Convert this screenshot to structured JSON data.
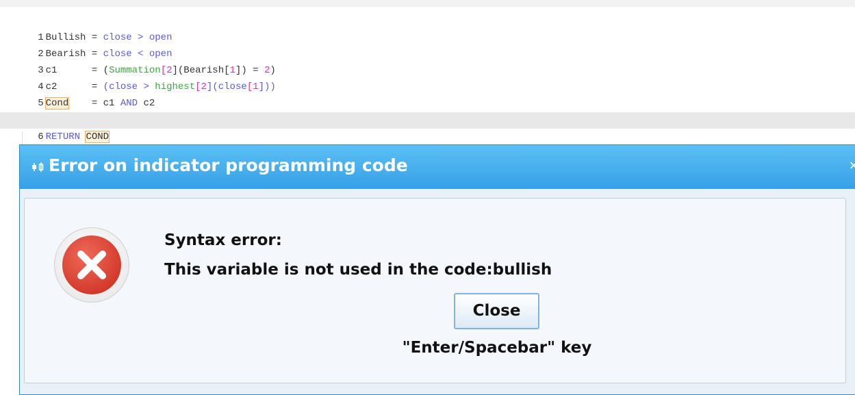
{
  "editor": {
    "lines": [
      {
        "num": "1",
        "var": "Bullish",
        "op": " = ",
        "rhs1": "close",
        "rhs_op": " > ",
        "rhs2": "open"
      },
      {
        "num": "2",
        "var": "Bearish",
        "op": " = ",
        "rhs1": "close",
        "rhs_op": " < ",
        "rhs2": "open"
      },
      {
        "num": "3",
        "var": "c1",
        "pad": "      ",
        "op": "= ",
        "t1": "(",
        "fn": "Summation",
        "b1": "[",
        "n1": "2",
        "b2": "](Bearish[",
        "n2": "1",
        "b3": "]) = ",
        "n3": "2",
        "b4": ")"
      },
      {
        "num": "4",
        "var": "c2",
        "pad": "      ",
        "op": "= ",
        "t1": "(",
        "kw1": "close",
        "t2": " > ",
        "fn": "highest",
        "b1": "[",
        "n1": "2",
        "b2": "](",
        "kw2": "close",
        "b3": "[",
        "n2": "1",
        "b4": "]))"
      },
      {
        "num": "5",
        "var": "Cond",
        "pad": "    ",
        "op": "= c1 ",
        "kw": "AND",
        "rest": " c2"
      },
      {
        "num": "6",
        "kw": "RETURN",
        "sp": " ",
        "var": "COND"
      }
    ]
  },
  "dialog": {
    "title": "Error on indicator programming code",
    "close_glyph": "×",
    "heading": "Syntax error:",
    "message": "This variable is not used in the code:bullish",
    "button_label": "Close",
    "hint": "\"Enter/Spacebar\" key",
    "icon": "error-circle-x-icon",
    "colors": {
      "titlebar": "#36a0e6",
      "error": "#d43b2c"
    }
  }
}
